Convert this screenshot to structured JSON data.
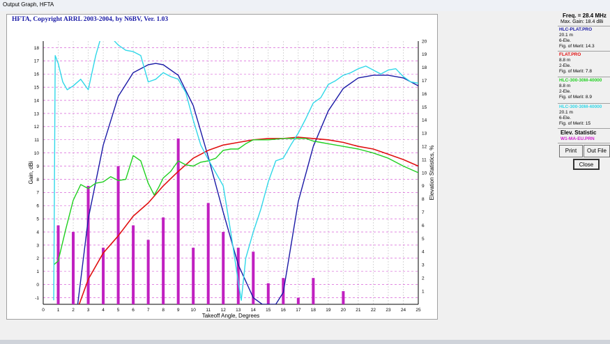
{
  "window": {
    "title": "Output Graph, HFTA"
  },
  "graph": {
    "title": "HFTA, Copyright ARRL 2003-2004, by N6BV, Ver. 1.03"
  },
  "side_panel": {
    "freq_label": "Freq. = 28.4 MHz",
    "max_gain_label": "Max. Gain: 18.4 dBi",
    "antennas": [
      {
        "name": "HLC-PLAT.PRO",
        "color": "#1a1aa6",
        "height": "20.1 m",
        "elements": "6-Ele.",
        "merit": "Fig. of Merit: 14.3"
      },
      {
        "name": "FLAT.PRO",
        "color": "#e01010",
        "height": "8.8 m",
        "elements": "2-Ele.",
        "merit": "Fig. of Merit: 7.8"
      },
      {
        "name": "HLC-300-30M-40000",
        "color": "#20d020",
        "height": "8.8 m",
        "elements": "2-Ele.",
        "merit": "Fig. of Merit: 8.9"
      },
      {
        "name": "HLC-300-30M-40000",
        "color": "#30d8e8",
        "height": "20.1 m",
        "elements": "6-Ele.",
        "merit": "Fig. of Merit: 15"
      }
    ],
    "elev_title": "Elev. Statistic",
    "elev_file": "W1-MA-EU.PRN",
    "print_label": "Print",
    "outfile_label": "Out File",
    "close_label": "Close"
  },
  "chart_data": {
    "type": "line",
    "xlabel": "Takeoff Angle, Degrees",
    "ylabel": "Gain, dBi",
    "y2label": "Elevation Statistics, %",
    "xlim": [
      0,
      25
    ],
    "ylim": [
      -1.5,
      18.5
    ],
    "y2lim": [
      0,
      20
    ],
    "x_ticks": [
      0,
      1,
      2,
      3,
      4,
      5,
      6,
      7,
      8,
      9,
      10,
      11,
      12,
      13,
      14,
      15,
      16,
      17,
      18,
      19,
      20,
      21,
      22,
      23,
      24,
      25
    ],
    "y_ticks": [
      -1,
      0,
      1,
      2,
      3,
      4,
      5,
      6,
      7,
      8,
      9,
      10,
      11,
      12,
      13,
      14,
      15,
      16,
      17,
      18
    ],
    "y2_ticks": [
      1,
      2,
      3,
      4,
      5,
      6,
      7,
      8,
      9,
      10,
      11,
      12,
      13,
      14,
      15,
      16,
      17,
      18,
      19,
      20
    ],
    "grid": true,
    "bars": {
      "name": "W1-MA-EU.PRN",
      "color": "#c020c0",
      "x": [
        1,
        2,
        3,
        4,
        5,
        6,
        7,
        8,
        9,
        10,
        11,
        12,
        13,
        14,
        15,
        16,
        17,
        18,
        20
      ],
      "values": [
        6.0,
        5.5,
        9.0,
        4.3,
        10.5,
        6.0,
        4.9,
        6.6,
        12.6,
        4.3,
        7.7,
        5.5,
        4.3,
        4.0,
        1.6,
        2.0,
        0.5,
        2.0,
        1.0
      ]
    },
    "series": [
      {
        "name": "HLC-PLAT.PRO",
        "color": "#1a1aa6",
        "x": [
          2.3,
          3,
          4,
          5,
          6,
          7,
          7.5,
          8,
          9,
          10,
          11,
          12,
          13,
          14,
          14.6,
          15.5,
          16,
          17,
          18,
          19,
          20,
          21,
          22,
          23,
          24,
          25
        ],
        "y": [
          -1.5,
          5,
          10.6,
          14.3,
          16.1,
          16.7,
          16.8,
          16.7,
          15.9,
          13.6,
          9.7,
          5.5,
          1.5,
          -1,
          -1.5,
          -1.5,
          -0.6,
          6.3,
          10.5,
          13.2,
          14.9,
          15.7,
          15.9,
          15.9,
          15.7,
          15.1
        ]
      },
      {
        "name": "FLAT.PRO",
        "color": "#e01010",
        "x": [
          2.4,
          3,
          4,
          5,
          6,
          7,
          8,
          9,
          10,
          11,
          12,
          13,
          14,
          15,
          16,
          17,
          18,
          19,
          20,
          21,
          22,
          23,
          24,
          25
        ],
        "y": [
          -1.5,
          0.4,
          2.4,
          3.7,
          5.2,
          6.2,
          7.5,
          8.6,
          9.6,
          10.2,
          10.6,
          10.8,
          11,
          11.1,
          11.1,
          11.2,
          11.1,
          11,
          10.8,
          10.5,
          10.3,
          9.9,
          9.5,
          9
        ]
      },
      {
        "name": "HLC-300-30M-40000",
        "color": "#20d020",
        "x": [
          0.7,
          1,
          1.5,
          2,
          2.5,
          3,
          3.5,
          4,
          4.5,
          5,
          5.5,
          6,
          6.5,
          7,
          7.4,
          7.7,
          8,
          8.5,
          9,
          9.5,
          10,
          10.5,
          11,
          11.5,
          12,
          12.5,
          13,
          13.5,
          14,
          14.5,
          15,
          16,
          17,
          17.5,
          18,
          18.5,
          19,
          20,
          21,
          22,
          23,
          24,
          25
        ],
        "y": [
          1.5,
          1.8,
          4.2,
          6.4,
          7.6,
          7.3,
          7.7,
          7.8,
          8.2,
          7.9,
          8,
          9.8,
          9.4,
          7.7,
          6.8,
          7.4,
          8.1,
          8.6,
          9.4,
          9.1,
          9,
          9.3,
          9.4,
          9.6,
          10.2,
          10.3,
          10.3,
          10.7,
          11,
          11,
          11,
          11.1,
          11.1,
          11.1,
          10.9,
          10.8,
          10.7,
          10.5,
          10.3,
          10,
          9.6,
          9,
          8.5
        ]
      },
      {
        "name": "HLC-300-30M-40000",
        "color": "#30d8e8",
        "x": [
          0.7,
          0.8,
          1,
          1.3,
          1.6,
          2,
          2.5,
          3,
          3.5,
          4,
          4.5,
          5,
          5.5,
          6,
          6.5,
          7,
          7.5,
          8,
          8.5,
          9,
          9.5,
          10,
          10.5,
          11,
          11.5,
          12,
          12.5,
          13,
          13.2,
          13.5,
          14,
          14.5,
          15,
          15.5,
          16,
          16.5,
          17,
          17.5,
          18,
          18.5,
          19,
          19.5,
          20,
          20.5,
          21,
          21.5,
          22,
          22.5,
          23,
          23.5,
          24,
          24.5,
          25
        ],
        "y": [
          -1.2,
          17.4,
          16.8,
          15.4,
          14.8,
          15.1,
          15.6,
          14.8,
          17.4,
          19.4,
          18.8,
          18.2,
          17.8,
          17.7,
          17.4,
          15.4,
          15.6,
          16.1,
          15.8,
          15.6,
          14.6,
          12.5,
          10.6,
          9.5,
          8.5,
          7.5,
          4,
          0.2,
          -1.2,
          2,
          4,
          5.7,
          7.8,
          9.4,
          9.6,
          10.6,
          11.5,
          12.6,
          13.8,
          14.2,
          15.2,
          15.5,
          15.9,
          16.1,
          16.4,
          16.6,
          16.3,
          16,
          16.3,
          16.4,
          15.8,
          15.4,
          15.3
        ]
      }
    ]
  }
}
